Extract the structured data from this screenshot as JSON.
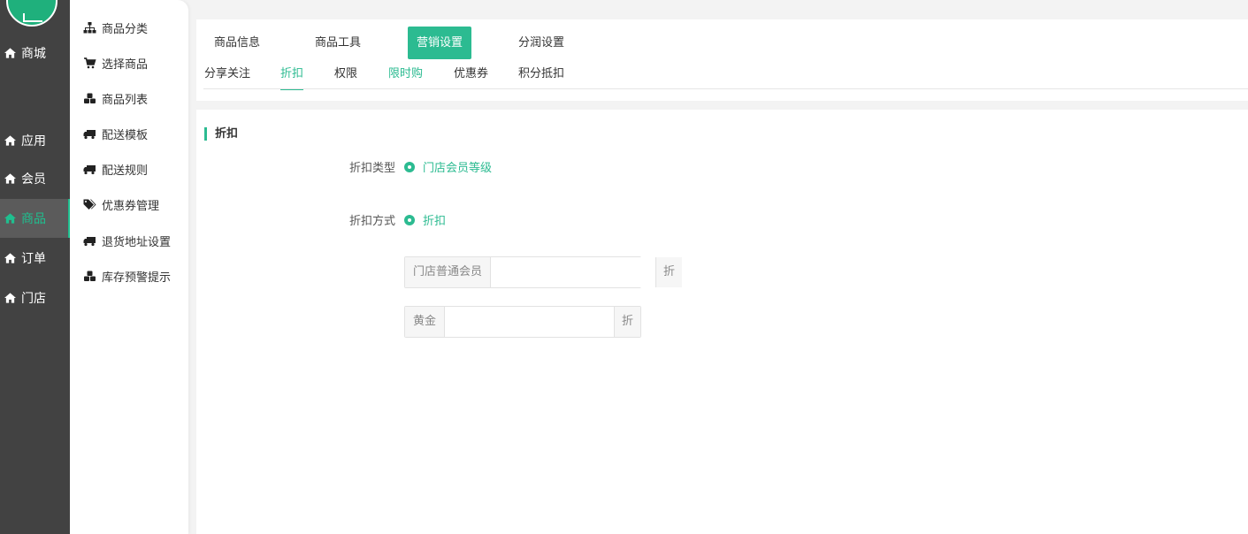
{
  "logo": {
    "text": ""
  },
  "main_nav": [
    {
      "label": "商城",
      "icon": "home-icon",
      "active": false
    },
    {
      "label": "应用",
      "icon": "home-icon",
      "active": false
    },
    {
      "label": "会员",
      "icon": "home-icon",
      "active": false
    },
    {
      "label": "商品",
      "icon": "home-icon",
      "active": true
    },
    {
      "label": "订单",
      "icon": "home-icon",
      "active": false
    },
    {
      "label": "门店",
      "icon": "home-icon",
      "active": false
    }
  ],
  "sub_nav": [
    {
      "label": "商品分类",
      "icon": "sitemap-icon"
    },
    {
      "label": "选择商品",
      "icon": "cart-icon"
    },
    {
      "label": "商品列表",
      "icon": "cubes-icon"
    },
    {
      "label": "配送模板",
      "icon": "truck-icon"
    },
    {
      "label": "配送规则",
      "icon": "truck-icon"
    },
    {
      "label": "优惠券管理",
      "icon": "tags-icon"
    },
    {
      "label": "退货地址设置",
      "icon": "truck-icon"
    },
    {
      "label": "库存预警提示",
      "icon": "cubes-icon"
    }
  ],
  "top_tabs": [
    {
      "label": "商品信息",
      "active": false
    },
    {
      "label": "商品工具",
      "active": false
    },
    {
      "label": "营销设置",
      "active": true
    },
    {
      "label": "分润设置",
      "active": false
    }
  ],
  "sub_tabs": [
    {
      "label": "分享关注",
      "state": "normal"
    },
    {
      "label": "折扣",
      "state": "active"
    },
    {
      "label": "权限",
      "state": "normal"
    },
    {
      "label": "限时购",
      "state": "green"
    },
    {
      "label": "优惠券",
      "state": "normal"
    },
    {
      "label": "积分抵扣",
      "state": "normal"
    }
  ],
  "section": {
    "title": "折扣"
  },
  "form": {
    "discount_type": {
      "label": "折扣类型",
      "option": "门店会员等级"
    },
    "discount_method": {
      "label": "折扣方式",
      "option": "折扣"
    },
    "levels": [
      {
        "name": "门店普通会员",
        "value": "",
        "suffix": "折"
      },
      {
        "name": "黄金",
        "value": "",
        "suffix": "折"
      }
    ]
  },
  "colors": {
    "accent": "#2cbb91",
    "nav_dark": "#424242",
    "nav_active_bg": "#5b5b5b"
  }
}
